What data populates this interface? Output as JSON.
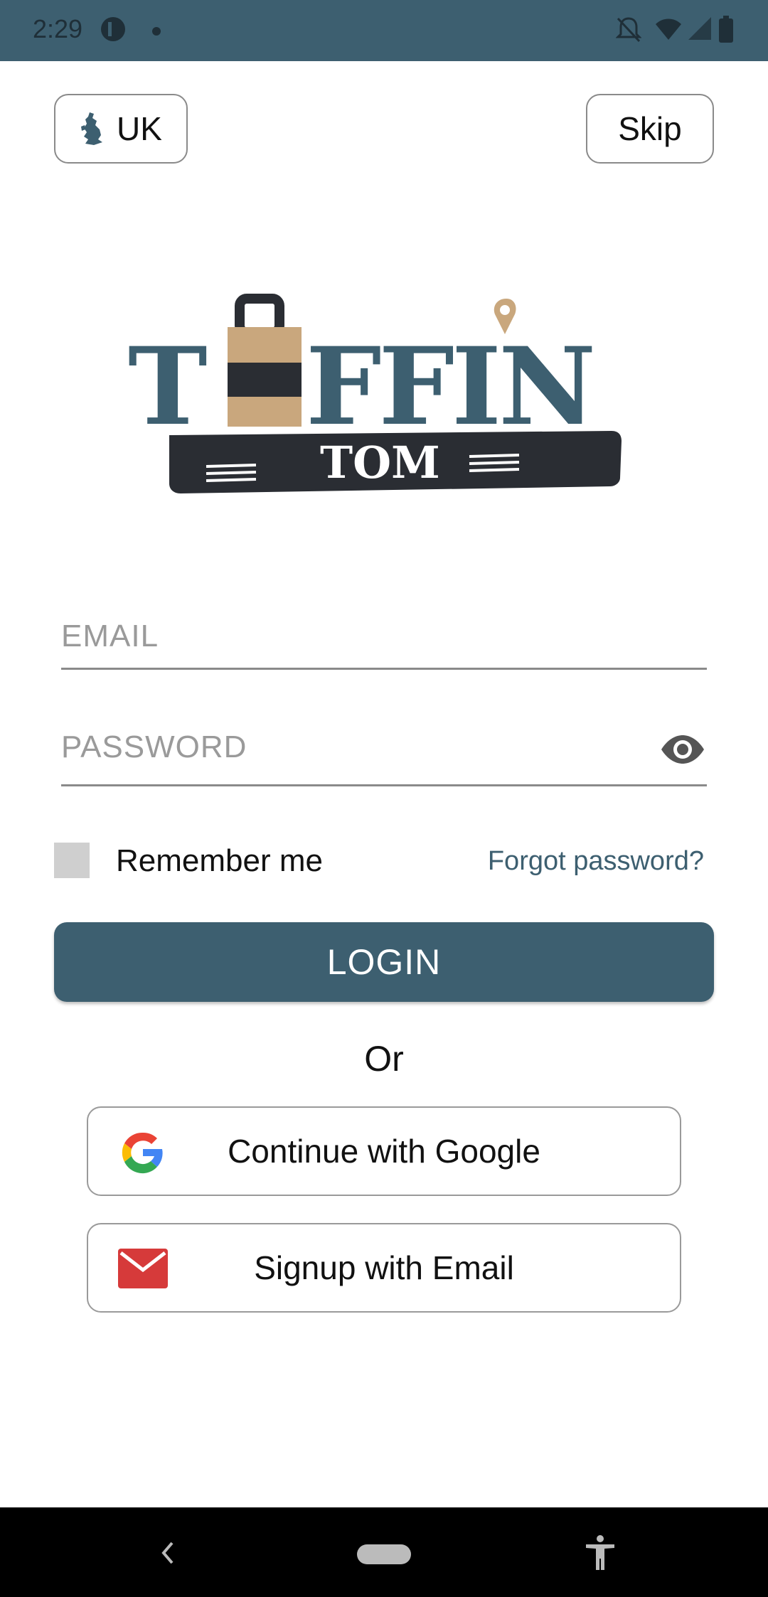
{
  "status_bar": {
    "time": "2:29",
    "icons": [
      "app-indicator-icon",
      "dot-icon",
      "notifications-off-icon",
      "wifi-icon",
      "signal-icon",
      "battery-icon"
    ]
  },
  "header": {
    "region_label": "UK",
    "region_icon": "uk-map-icon",
    "skip_label": "Skip"
  },
  "logo": {
    "word_top": "TIFFIN",
    "word_bottom": "TOM"
  },
  "form": {
    "email_placeholder": "EMAIL",
    "password_placeholder": "PASSWORD",
    "remember_label": "Remember me",
    "forgot_label": "Forgot password?",
    "login_label": "LOGIN",
    "or_label": "Or",
    "google_label": "Continue with Google",
    "email_signup_label": "Signup with Email"
  },
  "colors": {
    "brand": "#3d5f70",
    "accent_tan": "#c9a77d",
    "dark": "#2a2d33",
    "email_red": "#d63a3a"
  },
  "nav_bar": {
    "icons": [
      "back-icon",
      "home-pill-icon",
      "accessibility-icon"
    ]
  }
}
